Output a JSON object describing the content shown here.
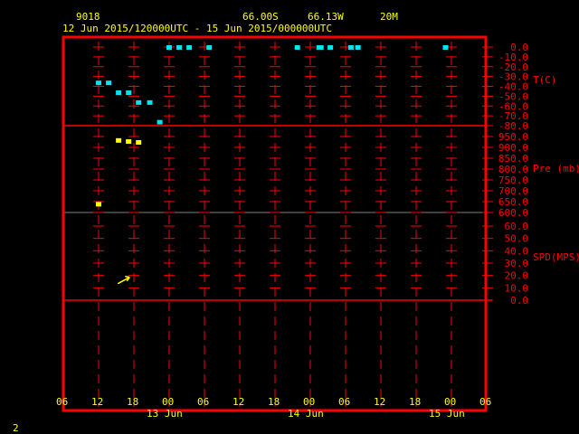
{
  "header": {
    "station": "9018",
    "latitude": "66.00S",
    "longitude": "66.13W",
    "height": "20M",
    "period": "12 Jun 2015/120000UTC - 15 Jun 2015/000000UTC"
  },
  "page_number": "2",
  "colors": {
    "frame": "#ff0000",
    "text": "#ffff00",
    "temperature": "#00e5ee",
    "pressure": "#ffff00",
    "wind": "#ffff00"
  },
  "chart_data": {
    "type": "scatter",
    "x_unit": "hours since 12 Jun 2015 12Z",
    "x_range": [
      -6,
      66
    ],
    "x_ticks": [
      "06",
      "12",
      "18",
      "00",
      "06",
      "12",
      "18",
      "00",
      "06",
      "12",
      "18",
      "00",
      "06"
    ],
    "date_labels": [
      {
        "label": "13 Jun",
        "hour": 12
      },
      {
        "label": "14 Jun",
        "hour": 36
      },
      {
        "label": "15 Jun",
        "hour": 60
      }
    ],
    "panels": [
      {
        "name": "temperature",
        "label": "T(C)",
        "ylim": [
          -80,
          0
        ],
        "ticks": [
          "0.0",
          "-10.0",
          "-20.0",
          "-30.0",
          "-40.0",
          "-50.0",
          "-60.0",
          "-70.0",
          "-80.0"
        ],
        "tick_values": [
          0,
          -10,
          -20,
          -30,
          -40,
          -50,
          -60,
          -70,
          -80
        ],
        "points": [
          {
            "x": 0,
            "y": -36
          },
          {
            "x": 1.7,
            "y": -36
          },
          {
            "x": 3.4,
            "y": -46
          },
          {
            "x": 5.1,
            "y": -46
          },
          {
            "x": 6.8,
            "y": -56
          },
          {
            "x": 8.7,
            "y": -56
          },
          {
            "x": 10.4,
            "y": -76
          },
          {
            "x": 12,
            "y": 0
          },
          {
            "x": 13.7,
            "y": 0
          },
          {
            "x": 15.4,
            "y": 0
          },
          {
            "x": 18.8,
            "y": 0
          },
          {
            "x": 33.8,
            "y": 0
          },
          {
            "x": 37.5,
            "y": 0
          },
          {
            "x": 37.8,
            "y": 0
          },
          {
            "x": 39.4,
            "y": 0
          },
          {
            "x": 42.9,
            "y": 0
          },
          {
            "x": 44.1,
            "y": 0
          },
          {
            "x": 59,
            "y": 0
          }
        ]
      },
      {
        "name": "pressure",
        "label": "Pre (mb)",
        "ylim": [
          600,
          950
        ],
        "ticks": [
          "950.0",
          "900.0",
          "850.0",
          "800.0",
          "750.0",
          "700.0",
          "650.0",
          "600.0"
        ],
        "tick_values": [
          950,
          900,
          850,
          800,
          750,
          700,
          650,
          600
        ],
        "points": [
          {
            "x": 0,
            "y": 640
          },
          {
            "x": 3.4,
            "y": 934
          },
          {
            "x": 5.1,
            "y": 929
          },
          {
            "x": 6.8,
            "y": 925
          }
        ]
      },
      {
        "name": "wind_speed",
        "label": "SPD(MPS)",
        "ylim": [
          0,
          60
        ],
        "ticks": [
          "60.0",
          "50.0",
          "40.0",
          "30.0",
          "20.0",
          "10.0",
          "0.0"
        ],
        "tick_values": [
          60,
          50,
          40,
          30,
          20,
          10,
          0
        ],
        "wind_arrows": [
          {
            "x": 4.5,
            "y": 20,
            "direction": "north-east"
          }
        ]
      }
    ]
  }
}
